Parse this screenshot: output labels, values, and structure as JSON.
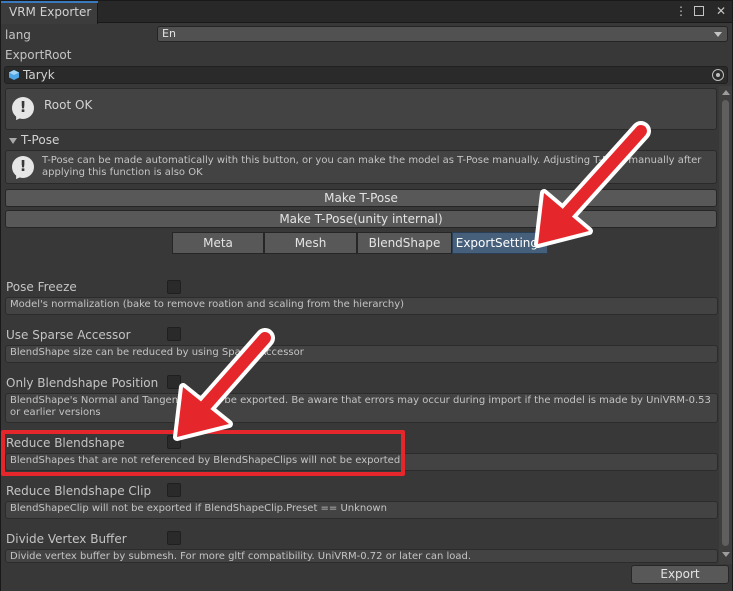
{
  "window": {
    "tab_title": "VRM Exporter",
    "menu_icon": "more-vertical-icon",
    "maximize_icon": "maximize-icon",
    "close_icon": "close-icon"
  },
  "lang": {
    "label": "lang",
    "value": "En"
  },
  "export_root": {
    "label": "ExportRoot",
    "object_name": "Taryk",
    "object_icon": "prefab-icon"
  },
  "root_status": {
    "text": "Root OK"
  },
  "tpose": {
    "header": "T-Pose",
    "help": "T-Pose can be made automatically with this button, or you can make the model as T-Pose manually. Adjusting T-Pose manually after applying this function is also OK",
    "make_tpose": "Make T-Pose",
    "make_tpose_internal": "Make T-Pose(unity internal)"
  },
  "tabs": [
    {
      "label": "Meta",
      "active": false
    },
    {
      "label": "Mesh",
      "active": false
    },
    {
      "label": "BlendShape",
      "active": false
    },
    {
      "label": "ExportSettings",
      "active": true
    }
  ],
  "settings": [
    {
      "label": "Pose Freeze",
      "checked": false,
      "info": "Model's normalization (bake to remove roation and scaling from the hierarchy)"
    },
    {
      "label": "Use Sparse Accessor",
      "checked": false,
      "info": "BlendShape size can be reduced by using Sparse Accessor"
    },
    {
      "label": "Only Blendshape Position",
      "checked": false,
      "info": "BlendShape's Normal and Tangent will not be exported. Be aware that errors may occur during import if the model is made by UniVRM-0.53 or earlier versions"
    },
    {
      "label": "Reduce Blendshape",
      "checked": false,
      "info": "BlendShapes that are not referenced by BlendShapeClips will not be exported"
    },
    {
      "label": "Reduce Blendshape Clip",
      "checked": false,
      "info": "BlendShapeClip will not be exported if BlendShapeClip.Preset == Unknown"
    },
    {
      "label": "Divide Vertex Buffer",
      "checked": false,
      "info": "Divide vertex buffer by submesh.  For more gltf compatibility.  UniVRM-0.72 or later can load."
    }
  ],
  "export_button": "Export",
  "colors": {
    "highlight": "#e5262a",
    "active_tab": "#46607c",
    "background": "#383838"
  }
}
